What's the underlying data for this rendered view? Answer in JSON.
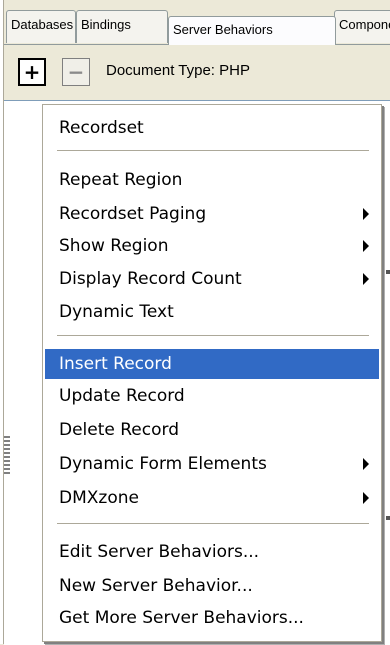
{
  "tabs": [
    {
      "label": "Databases"
    },
    {
      "label": "Bindings"
    },
    {
      "label": "Server Behaviors"
    },
    {
      "label": "Components"
    }
  ],
  "toolbar": {
    "add_glyph": "+",
    "remove_glyph": "−",
    "document_type": "Document Type: PHP"
  },
  "menu": {
    "highlight_color": "#316ac5",
    "items": [
      {
        "label": "Recordset",
        "submenu": false
      },
      {
        "label": "Repeat Region",
        "submenu": false
      },
      {
        "label": "Recordset Paging",
        "submenu": true
      },
      {
        "label": "Show Region",
        "submenu": true
      },
      {
        "label": "Display Record Count",
        "submenu": true
      },
      {
        "label": "Dynamic Text",
        "submenu": false
      },
      {
        "label": "Insert Record",
        "submenu": false,
        "highlighted": true
      },
      {
        "label": "Update Record",
        "submenu": false
      },
      {
        "label": "Delete Record",
        "submenu": false
      },
      {
        "label": "Dynamic Form Elements",
        "submenu": true
      },
      {
        "label": "DMXzone",
        "submenu": true
      },
      {
        "label": "Edit Server Behaviors...",
        "submenu": false
      },
      {
        "label": "New Server Behavior...",
        "submenu": false
      },
      {
        "label": "Get More Server Behaviors...",
        "submenu": false
      }
    ]
  }
}
